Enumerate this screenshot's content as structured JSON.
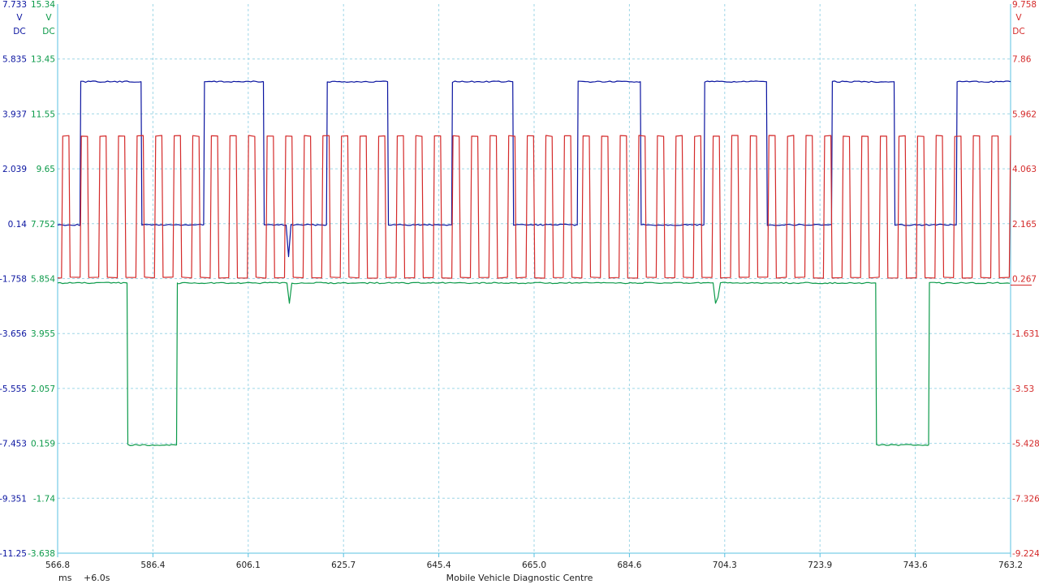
{
  "chart_data": {
    "type": "line",
    "footer": {
      "time_unit": "ms",
      "offset": "+6.0s",
      "branding": "Mobile Vehicle Diagnostic Centre"
    },
    "x_axis": {
      "range": [
        566.8,
        763.2
      ],
      "ticks": [
        "566.8",
        "586.4",
        "606.1",
        "625.7",
        "645.4",
        "665.0",
        "684.6",
        "704.3",
        "723.9",
        "743.6",
        "763.2"
      ]
    },
    "axes": [
      {
        "id": "blue",
        "color": "#0a14a0",
        "side": "left",
        "unit": "V",
        "coupling": "DC",
        "range": [
          -11.25,
          7.733
        ],
        "ticks": [
          "7.733",
          "5.835",
          "3.937",
          "2.039",
          "0.14",
          "-1.758",
          "-3.656",
          "-5.555",
          "-7.453",
          "-9.351",
          "-11.25"
        ]
      },
      {
        "id": "green",
        "color": "#0c9a4a",
        "side": "left",
        "unit": "V",
        "coupling": "DC",
        "range": [
          -3.638,
          15.34
        ],
        "ticks": [
          "15.34",
          "13.45",
          "11.55",
          "9.65",
          "7.752",
          "5.854",
          "3.955",
          "2.057",
          "0.159",
          "-1.74",
          "-3.638"
        ]
      },
      {
        "id": "red",
        "color": "#d42a2a",
        "side": "right",
        "unit": "V",
        "coupling": "DC",
        "range": [
          -9.224,
          9.758
        ],
        "ticks": [
          "9.758",
          "7.86",
          "5.962",
          "4.063",
          "2.165",
          "0.267",
          "-1.631",
          "-3.53",
          "-5.428",
          "-7.326",
          "-9.224"
        ]
      }
    ],
    "series": [
      {
        "axis": "blue",
        "low": 0.1,
        "high": 5.05,
        "high_intervals": [
          [
            571.4,
            584.0
          ],
          [
            596.9,
            609.2
          ],
          [
            622.2,
            634.8
          ],
          [
            648.0,
            660.6
          ],
          [
            673.9,
            686.9
          ],
          [
            700.0,
            712.9
          ],
          [
            726.3,
            739.2
          ],
          [
            752.0,
            763.2
          ]
        ],
        "glitches": [
          [
            614.5,
            -1.0
          ],
          [
            702.6,
            -1.2
          ],
          [
            703.0,
            -0.5
          ]
        ]
      },
      {
        "axis": "green",
        "low": 0.1,
        "high": 5.7,
        "low_intervals": [
          [
            581.1,
            591.3
          ],
          [
            735.4,
            746.3
          ]
        ],
        "glitches": [
          [
            614.5,
            5.0
          ],
          [
            702.6,
            5.0
          ],
          [
            703.0,
            5.2
          ]
        ]
      },
      {
        "axis": "red",
        "low": 0.3,
        "high": 5.2,
        "period_ms": 3.83,
        "first_rise_ms": 567.6,
        "duty_high": 0.4
      }
    ]
  }
}
